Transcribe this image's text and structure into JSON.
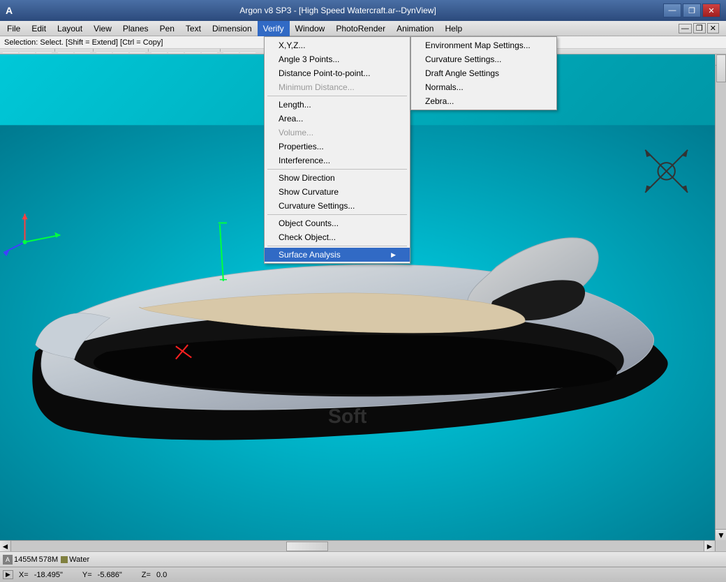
{
  "title_bar": {
    "app_icon": "A",
    "title": "Argon v8 SP3 - [High Speed Watercraft.ar--DynView]",
    "min_btn": "—",
    "restore_btn": "❐",
    "close_btn": "✕"
  },
  "menu_bar": {
    "items": [
      {
        "label": "File",
        "id": "file"
      },
      {
        "label": "Edit",
        "id": "edit"
      },
      {
        "label": "Layout",
        "id": "layout"
      },
      {
        "label": "View",
        "id": "view"
      },
      {
        "label": "Planes",
        "id": "planes"
      },
      {
        "label": "Pen",
        "id": "pen"
      },
      {
        "label": "Text",
        "id": "text"
      },
      {
        "label": "Dimension",
        "id": "dimension"
      },
      {
        "label": "Verify",
        "id": "verify",
        "active": true
      },
      {
        "label": "Window",
        "id": "window"
      },
      {
        "label": "PhotoRender",
        "id": "photorender"
      },
      {
        "label": "Animation",
        "id": "animation"
      },
      {
        "label": "Help",
        "id": "help"
      }
    ],
    "inner_items": [
      {
        "label": "📄",
        "id": "inner-file"
      },
      {
        "label": "❌",
        "id": "inner-close"
      }
    ]
  },
  "selection_status": "Selection: Select. [Shift = Extend] [Ctrl = Copy]",
  "verify_menu": {
    "items": [
      {
        "label": "X,Y,Z...",
        "id": "xyz",
        "disabled": false,
        "has_submenu": false
      },
      {
        "label": "Angle 3 Points...",
        "id": "angle3",
        "disabled": false,
        "has_submenu": false
      },
      {
        "label": "Distance Point-to-point...",
        "id": "distance",
        "disabled": false,
        "has_submenu": false
      },
      {
        "label": "Minimum Distance...",
        "id": "mindistance",
        "disabled": true,
        "has_submenu": false
      },
      {
        "label": "sep1",
        "type": "sep"
      },
      {
        "label": "Length...",
        "id": "length",
        "disabled": false,
        "has_submenu": false
      },
      {
        "label": "Area...",
        "id": "area",
        "disabled": false,
        "has_submenu": false
      },
      {
        "label": "Volume...",
        "id": "volume",
        "disabled": true,
        "has_submenu": false
      },
      {
        "label": "Properties...",
        "id": "properties",
        "disabled": false,
        "has_submenu": false
      },
      {
        "label": "Interference...",
        "id": "interference",
        "disabled": false,
        "has_submenu": false
      },
      {
        "label": "sep2",
        "type": "sep"
      },
      {
        "label": "Show Direction",
        "id": "showdir",
        "disabled": false,
        "has_submenu": false
      },
      {
        "label": "Show Curvature",
        "id": "showcurv",
        "disabled": false,
        "has_submenu": false
      },
      {
        "label": "Curvature Settings...",
        "id": "curvsettings",
        "disabled": false,
        "has_submenu": false
      },
      {
        "label": "sep3",
        "type": "sep"
      },
      {
        "label": "Object Counts...",
        "id": "objectcounts",
        "disabled": false,
        "has_submenu": false
      },
      {
        "label": "Check Object...",
        "id": "checkobject",
        "disabled": false,
        "has_submenu": false
      },
      {
        "label": "sep4",
        "type": "sep"
      },
      {
        "label": "Surface Analysis",
        "id": "surfaceanalysis",
        "disabled": false,
        "has_submenu": true,
        "active": true
      }
    ]
  },
  "surface_submenu": {
    "items": [
      {
        "label": "Environment Map Settings...",
        "id": "envmap"
      },
      {
        "label": "Curvature Settings...",
        "id": "curvsettings2"
      },
      {
        "label": "Draft Angle Settings",
        "id": "draftangle"
      },
      {
        "label": "Normals...",
        "id": "normals"
      },
      {
        "label": "Zebra...",
        "id": "zebra"
      }
    ]
  },
  "status_bar": {
    "memory": "1455M",
    "memory2": "578M",
    "layer": "Water",
    "coords": {
      "x_label": "X=",
      "x_val": "-18.495\"",
      "y_label": "Y=",
      "y_val": "-5.686\"",
      "z_label": "Z=",
      "z_val": "0.0"
    }
  }
}
